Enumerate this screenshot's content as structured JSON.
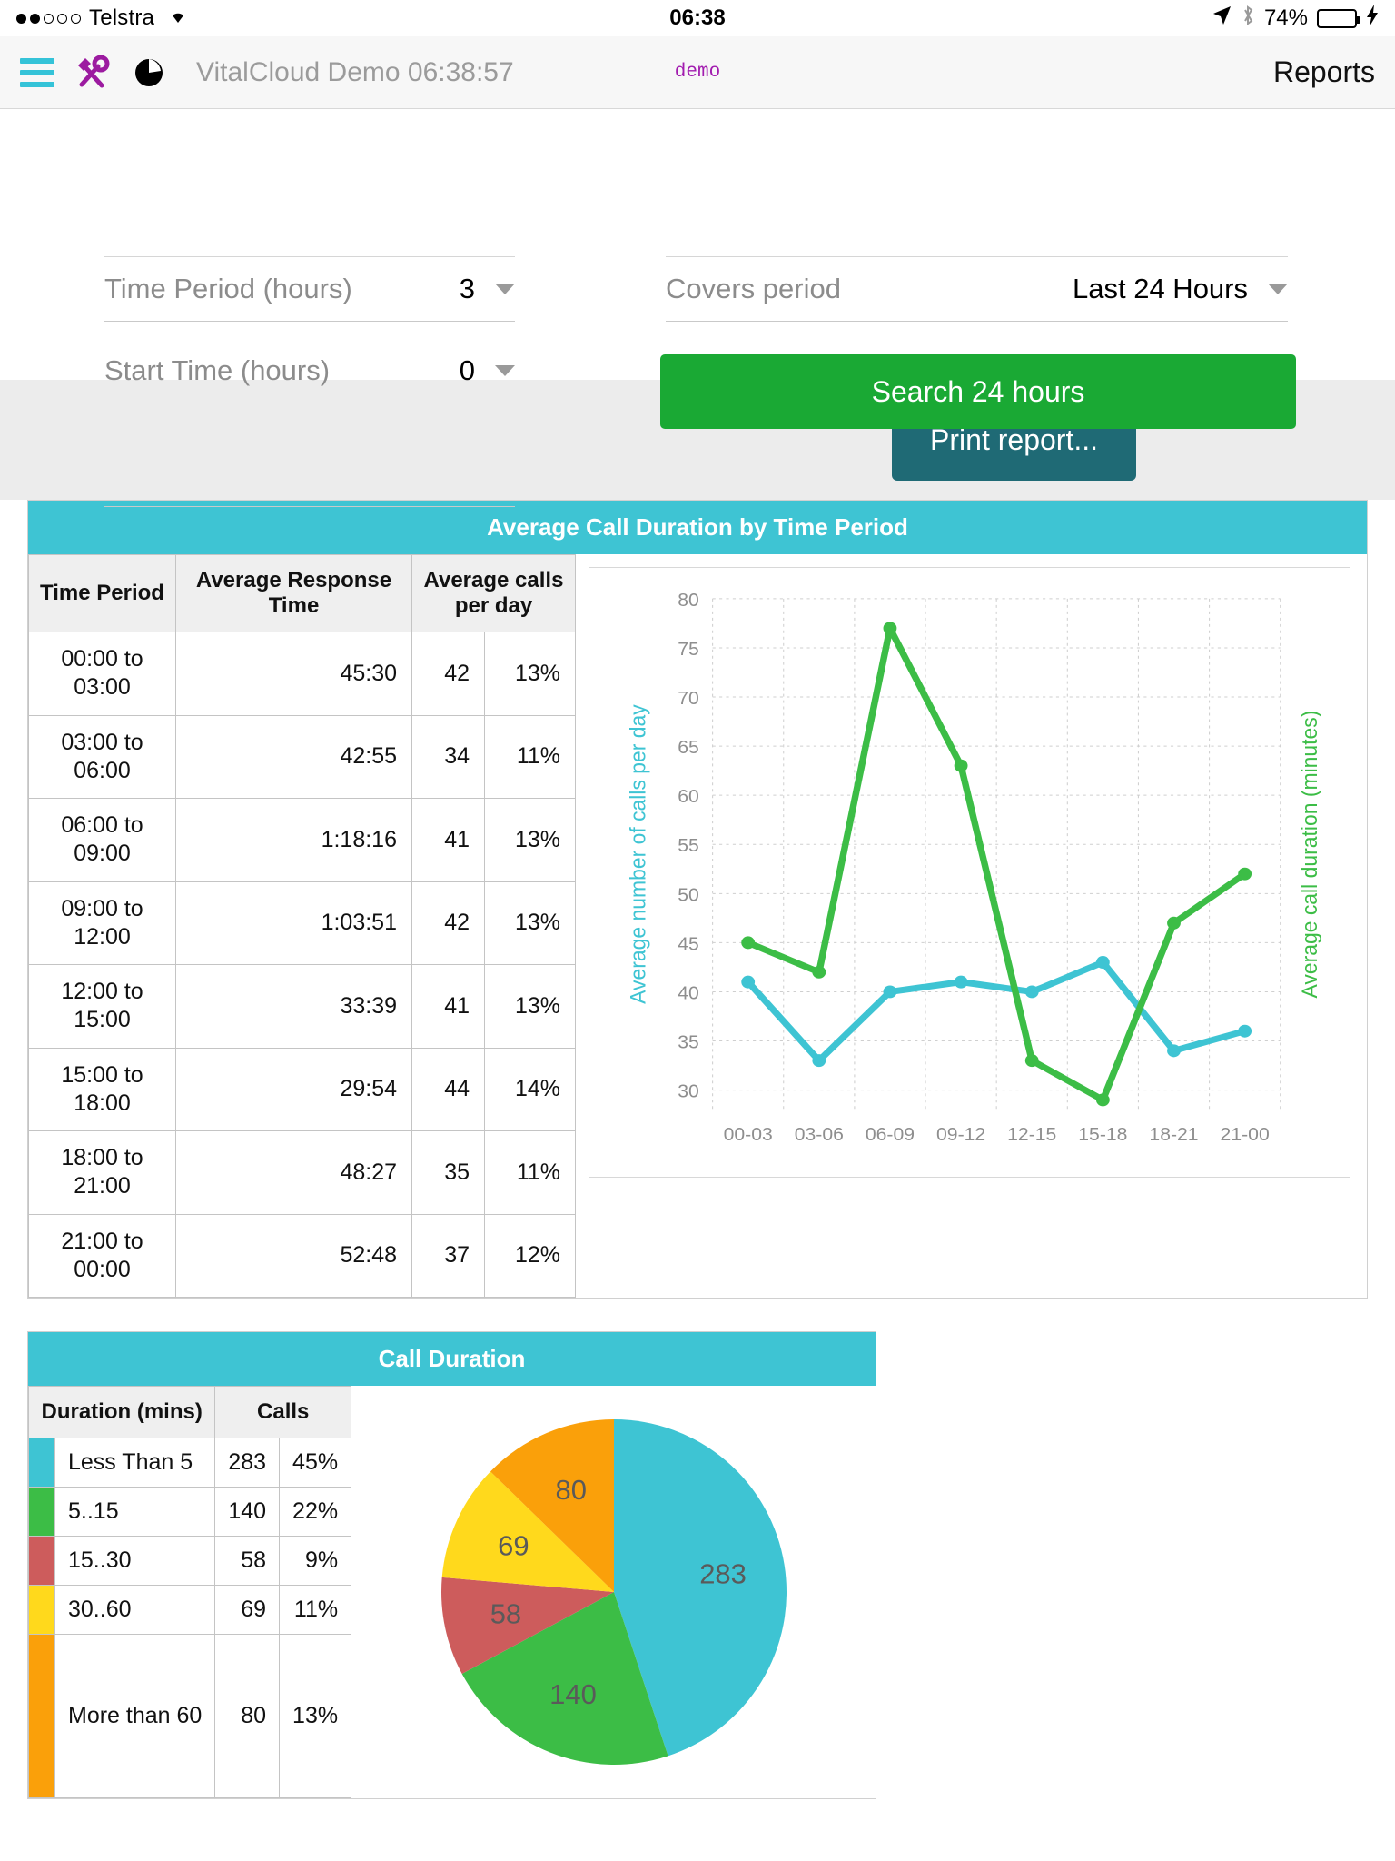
{
  "status_bar": {
    "carrier": "Telstra",
    "signal_dots_filled": 2,
    "signal_dots_total": 5,
    "wifi_icon": "wifi-icon",
    "time": "06:38",
    "location_icon": "location-arrow-icon",
    "bluetooth_icon": "bluetooth-icon",
    "battery_percent": "74%",
    "battery_level": 74,
    "battery_color": "#4cd964",
    "charging_icon": "lightning-bolt-icon"
  },
  "header": {
    "menu_icon": "hamburger-menu-icon",
    "tools_icon": "tools-icon",
    "chart_icon": "pie-chart-icon",
    "title": "VitalCloud Demo 06:38:57",
    "tenant": "demo",
    "reports_link": "Reports",
    "menu_color": "#35c3d8",
    "tools_color": "#9c1ba0",
    "tenant_color": "#a21caf"
  },
  "form": {
    "time_period": {
      "label": "Time Period (hours)",
      "value": "3"
    },
    "start_time": {
      "label": "Start Time (hours)",
      "value": "0"
    },
    "covers_period": {
      "label": "Covers period",
      "value": "Last 24 Hours"
    },
    "search_button": "Search 24 hours",
    "search_button_color": "#1aa934"
  },
  "toolbar": {
    "print_label": "Print report...",
    "print_color": "#1f6a75"
  },
  "panel_time": {
    "title": "Average Call Duration by Time Period",
    "title_color": "#3ec4d3",
    "columns": [
      "Time Period",
      "Average Response Time",
      "Average calls per day"
    ],
    "rows": [
      {
        "period": "00:00 to 03:00",
        "response_time": "45:30",
        "calls": "42",
        "percent": "13%"
      },
      {
        "period": "03:00 to 06:00",
        "response_time": "42:55",
        "calls": "34",
        "percent": "11%"
      },
      {
        "period": "06:00 to 09:00",
        "response_time": "1:18:16",
        "calls": "41",
        "percent": "13%"
      },
      {
        "period": "09:00 to 12:00",
        "response_time": "1:03:51",
        "calls": "42",
        "percent": "13%"
      },
      {
        "period": "12:00 to 15:00",
        "response_time": "33:39",
        "calls": "41",
        "percent": "13%"
      },
      {
        "period": "15:00 to 18:00",
        "response_time": "29:54",
        "calls": "44",
        "percent": "14%"
      },
      {
        "period": "18:00 to 21:00",
        "response_time": "48:27",
        "calls": "35",
        "percent": "11%"
      },
      {
        "period": "21:00 to 00:00",
        "response_time": "52:48",
        "calls": "37",
        "percent": "12%"
      }
    ]
  },
  "panel_pie": {
    "title": "Call Duration",
    "title_color": "#3ec4d3",
    "columns": [
      "Duration (mins)",
      "Calls"
    ],
    "rows": [
      {
        "color": "#3ec4d3",
        "label": "Less Than 5",
        "calls": "283",
        "percent": "45%"
      },
      {
        "color": "#3cbd46",
        "label": "5..15",
        "calls": "140",
        "percent": "22%"
      },
      {
        "color": "#cd5c5c",
        "label": "15..30",
        "calls": "58",
        "percent": "9%"
      },
      {
        "color": "#ffd91c",
        "label": "30..60",
        "calls": "69",
        "percent": "11%"
      },
      {
        "color": "#faa00a",
        "label": "More than 60",
        "calls": "80",
        "percent": "13%"
      }
    ]
  },
  "chart_data": [
    {
      "type": "line",
      "title": "Average Call Duration by Time Period",
      "xlabel": "Time Period",
      "ylabel": "Average number of calls per day",
      "y2label": "Average call duration (minutes)",
      "categories": [
        "00-03",
        "03-06",
        "06-09",
        "09-12",
        "12-15",
        "15-18",
        "18-21",
        "21-00"
      ],
      "ylim": [
        28,
        80
      ],
      "yticks": [
        30,
        35,
        40,
        45,
        50,
        55,
        60,
        65,
        70,
        75,
        80
      ],
      "grid": true,
      "legend": "none",
      "series": [
        {
          "name": "Average number of calls per day",
          "color": "#3ec4d3",
          "axis": "left",
          "values": [
            41,
            33,
            40,
            41,
            40,
            43,
            34,
            36
          ]
        },
        {
          "name": "Average call duration (minutes)",
          "color": "#3cbd46",
          "axis": "right",
          "values": [
            45,
            42,
            77,
            63,
            33,
            29,
            47,
            52
          ]
        }
      ]
    },
    {
      "type": "pie",
      "title": "Call Duration",
      "labels": [
        "Less Than 5",
        "5..15",
        "15..30",
        "30..60",
        "More than 60"
      ],
      "values": [
        283,
        140,
        58,
        69,
        80
      ],
      "percents": [
        "45%",
        "22%",
        "9%",
        "11%",
        "13%"
      ],
      "colors": [
        "#3ec4d3",
        "#3cbd46",
        "#cd5c5c",
        "#ffd91c",
        "#faa00a"
      ],
      "data_labels": [
        "283",
        "140",
        "58",
        "69",
        "80"
      ],
      "legend": "table-left"
    }
  ]
}
